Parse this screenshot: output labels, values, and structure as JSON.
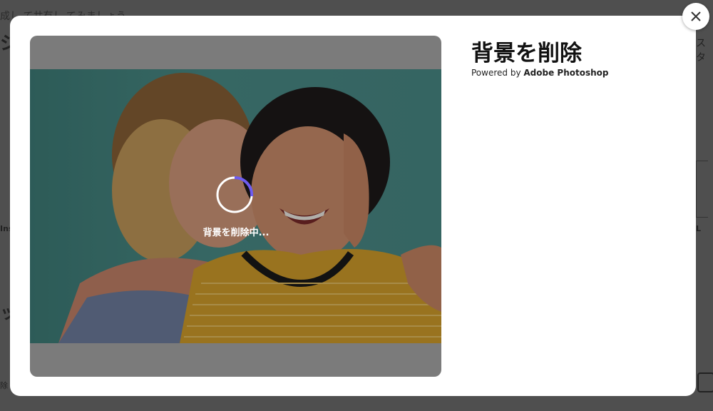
{
  "background": {
    "top_text": "成し て共有し てみましょう",
    "left_glyph_1": "ジ",
    "left_glyph_2": "ッ",
    "left_label": "Ins",
    "left_bottom": "除",
    "right_top": "スタ",
    "right_label": "L"
  },
  "modal": {
    "title": "背景を削除",
    "powered_prefix": "Powered by ",
    "powered_brand": "Adobe Photoshop",
    "loading_text": "背景を削除中...",
    "close_icon": "close-icon"
  },
  "colors": {
    "accent": "#6e5cf0",
    "photo_bg": "#4a8c88",
    "preview_gray": "#7b7b7b"
  }
}
